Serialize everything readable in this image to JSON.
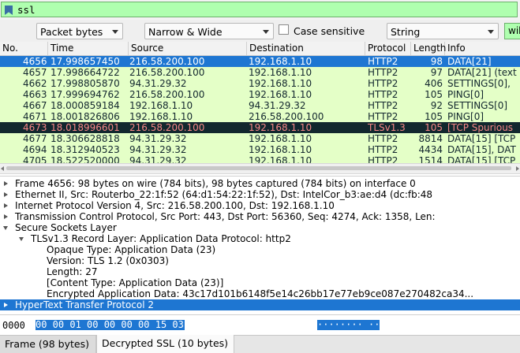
{
  "filter": {
    "value": "ssl"
  },
  "find": {
    "search_in": "Packet bytes",
    "char_width": "Narrow & Wide",
    "case_sensitive_label": "Case sensitive",
    "search_type": "String",
    "search_value": "wik"
  },
  "packet_list": {
    "columns": [
      "No.",
      "Time",
      "Source",
      "Destination",
      "Protocol",
      "Length",
      "Info"
    ],
    "rows": [
      {
        "no": "4656",
        "time": "17.998657450",
        "src": "216.58.200.100",
        "dst": "192.168.1.10",
        "proto": "HTTP2",
        "len": "98",
        "info": "DATA[21]",
        "style": "selected"
      },
      {
        "no": "4657",
        "time": "17.998664722",
        "src": "216.58.200.100",
        "dst": "192.168.1.10",
        "proto": "HTTP2",
        "len": "97",
        "info": "DATA[21] (text",
        "style": "green"
      },
      {
        "no": "4662",
        "time": "17.998805870",
        "src": "94.31.29.32",
        "dst": "192.168.1.10",
        "proto": "HTTP2",
        "len": "406",
        "info": "SETTINGS[0],",
        "style": "green"
      },
      {
        "no": "4663",
        "time": "17.999694762",
        "src": "216.58.200.100",
        "dst": "192.168.1.10",
        "proto": "HTTP2",
        "len": "105",
        "info": "PING[0]",
        "style": "green"
      },
      {
        "no": "4667",
        "time": "18.000859184",
        "src": "192.168.1.10",
        "dst": "94.31.29.32",
        "proto": "HTTP2",
        "len": "92",
        "info": "SETTINGS[0]",
        "style": "green"
      },
      {
        "no": "4671",
        "time": "18.001826806",
        "src": "192.168.1.10",
        "dst": "216.58.200.100",
        "proto": "HTTP2",
        "len": "105",
        "info": "PING[0]",
        "style": "green"
      },
      {
        "no": "4673",
        "time": "18.018996601",
        "src": "216.58.200.100",
        "dst": "192.168.1.10",
        "proto": "TLSv1.3",
        "len": "105",
        "info": "[TCP Spurious",
        "style": "dark"
      },
      {
        "no": "4677",
        "time": "18.306628818",
        "src": "94.31.29.32",
        "dst": "192.168.1.10",
        "proto": "HTTP2",
        "len": "8814",
        "info": "DATA[15] [TCP",
        "style": "green"
      },
      {
        "no": "4694",
        "time": "18.312940523",
        "src": "94.31.29.32",
        "dst": "192.168.1.10",
        "proto": "HTTP2",
        "len": "4434",
        "info": "DATA[15], DAT",
        "style": "green"
      },
      {
        "no": "4705",
        "time": "18.522520000",
        "src": "94.31.29.32",
        "dst": "192.168.1.10",
        "proto": "HTTP2",
        "len": "1514",
        "info": "DATA[15] [TCP",
        "style": "green"
      }
    ]
  },
  "details": [
    {
      "text": "Frame 4656: 98 bytes on wire (784 bits), 98 bytes captured (784 bits) on interface 0",
      "indent": 0,
      "expander": "collapsed",
      "selected": false
    },
    {
      "text": "Ethernet II, Src: Routerbo_22:1f:52 (64:d1:54:22:1f:52), Dst: IntelCor_b3:ae:d4 (dc:fb:48",
      "indent": 0,
      "expander": "collapsed",
      "selected": false
    },
    {
      "text": "Internet Protocol Version 4, Src: 216.58.200.100, Dst: 192.168.1.10",
      "indent": 0,
      "expander": "collapsed",
      "selected": false
    },
    {
      "text": "Transmission Control Protocol, Src Port: 443, Dst Port: 56360, Seq: 4274, Ack: 1358, Len:",
      "indent": 0,
      "expander": "collapsed",
      "selected": false
    },
    {
      "text": "Secure Sockets Layer",
      "indent": 0,
      "expander": "expanded",
      "selected": false
    },
    {
      "text": "TLSv1.3 Record Layer: Application Data Protocol: http2",
      "indent": 1,
      "expander": "expanded",
      "selected": false
    },
    {
      "text": "Opaque Type: Application Data (23)",
      "indent": 2,
      "expander": "none",
      "selected": false
    },
    {
      "text": "Version: TLS 1.2 (0x0303)",
      "indent": 2,
      "expander": "none",
      "selected": false
    },
    {
      "text": "Length: 27",
      "indent": 2,
      "expander": "none",
      "selected": false
    },
    {
      "text": "[Content Type: Application Data (23)]",
      "indent": 2,
      "expander": "none",
      "selected": false
    },
    {
      "text": "Encrypted Application Data: 43c17d101b6148f5e14c26bb17e77eb9ce087e270482ca34...",
      "indent": 2,
      "expander": "none",
      "selected": false
    },
    {
      "text": "HyperText Transfer Protocol 2",
      "indent": 0,
      "expander": "collapsed",
      "selected": true
    }
  ],
  "bytes": {
    "offset": "0000",
    "hex": "00 00 01 00 00 00 00  15 03",
    "ascii": "········ ··"
  },
  "tabs": [
    "Frame (98 bytes)",
    "Decrypted SSL (10 bytes)"
  ]
}
